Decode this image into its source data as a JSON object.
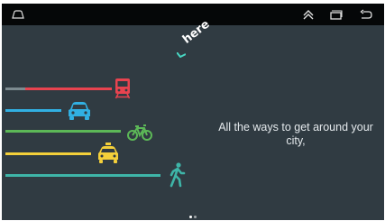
{
  "app": {
    "tagline": "All the ways to get around your city,",
    "logo_text": "here",
    "logo_icon": "here-logo"
  },
  "status_bar": {
    "left_icon": "rounded-rect-icon",
    "right_icons": [
      "double-chevron-up-icon",
      "recent-apps-icon",
      "back-icon"
    ]
  },
  "transport_modes": [
    {
      "name": "train",
      "icon": "train-icon",
      "color": "#e8434f"
    },
    {
      "name": "car",
      "icon": "car-icon",
      "color": "#31b0e2"
    },
    {
      "name": "bicycle",
      "icon": "bicycle-icon",
      "color": "#5cb857"
    },
    {
      "name": "taxi",
      "icon": "taxi-icon",
      "color": "#f4d03a"
    },
    {
      "name": "walk",
      "icon": "walking-icon",
      "color": "#3eb5a8"
    }
  ],
  "pager": {
    "page_count": 2,
    "current_page": 1
  },
  "colors": {
    "background": "#303b42",
    "status_bar": "#050708",
    "text": "#e4e9ec"
  }
}
